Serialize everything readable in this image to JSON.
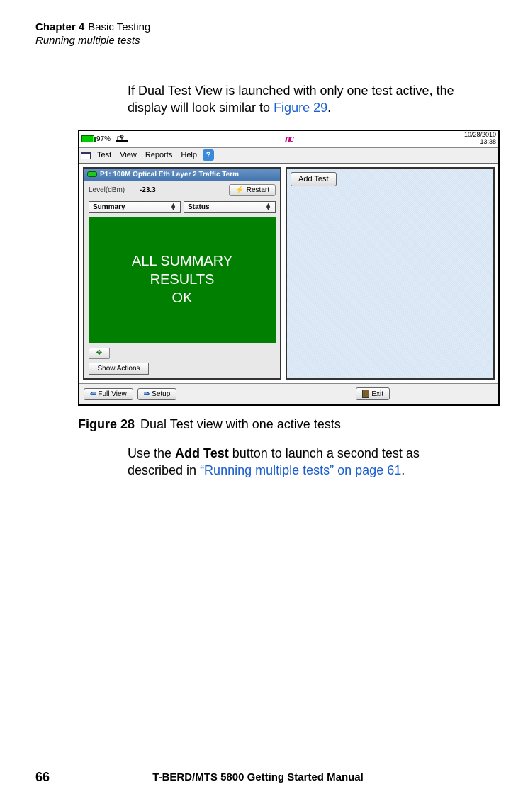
{
  "header": {
    "chapter_label": "Chapter 4",
    "chapter_title": "Basic Testing",
    "section_title": "Running multiple tests"
  },
  "paragraph1": {
    "text_before": "If Dual Test View is launched with only one test active, the display will look similar to ",
    "link": "Figure 29",
    "text_after": "."
  },
  "screenshot": {
    "status_bar": {
      "battery_pct": "97%",
      "logo": "nc",
      "date": "10/28/2010",
      "time": "13:38"
    },
    "menu": {
      "items": [
        "Test",
        "View",
        "Reports",
        "Help"
      ],
      "help_icon": "?"
    },
    "left_panel": {
      "title": "P1: 100M Optical Eth Layer 2 Traffic Term",
      "level_label": "Level(dBm)",
      "level_value": "-23.3",
      "restart_label": "Restart",
      "dropdown1": "Summary",
      "dropdown2": "Status",
      "display_line1": "ALL SUMMARY",
      "display_line2": "RESULTS",
      "display_line3": "OK",
      "move_icon": "✥",
      "show_actions": "Show Actions"
    },
    "right_panel": {
      "add_test": "Add Test"
    },
    "bottom_bar": {
      "full_view": "Full View",
      "setup": "Setup",
      "exit": "Exit"
    }
  },
  "figure_caption": {
    "label": "Figure 28",
    "text": "Dual Test view with one active tests"
  },
  "paragraph2": {
    "text_before": "Use the ",
    "bold": "Add Test",
    "text_mid": " button to launch a second test as described in ",
    "link": "“Running multiple tests” on page 61",
    "text_after": "."
  },
  "footer": {
    "page": "66",
    "title": "T-BERD/MTS 5800 Getting Started Manual"
  }
}
